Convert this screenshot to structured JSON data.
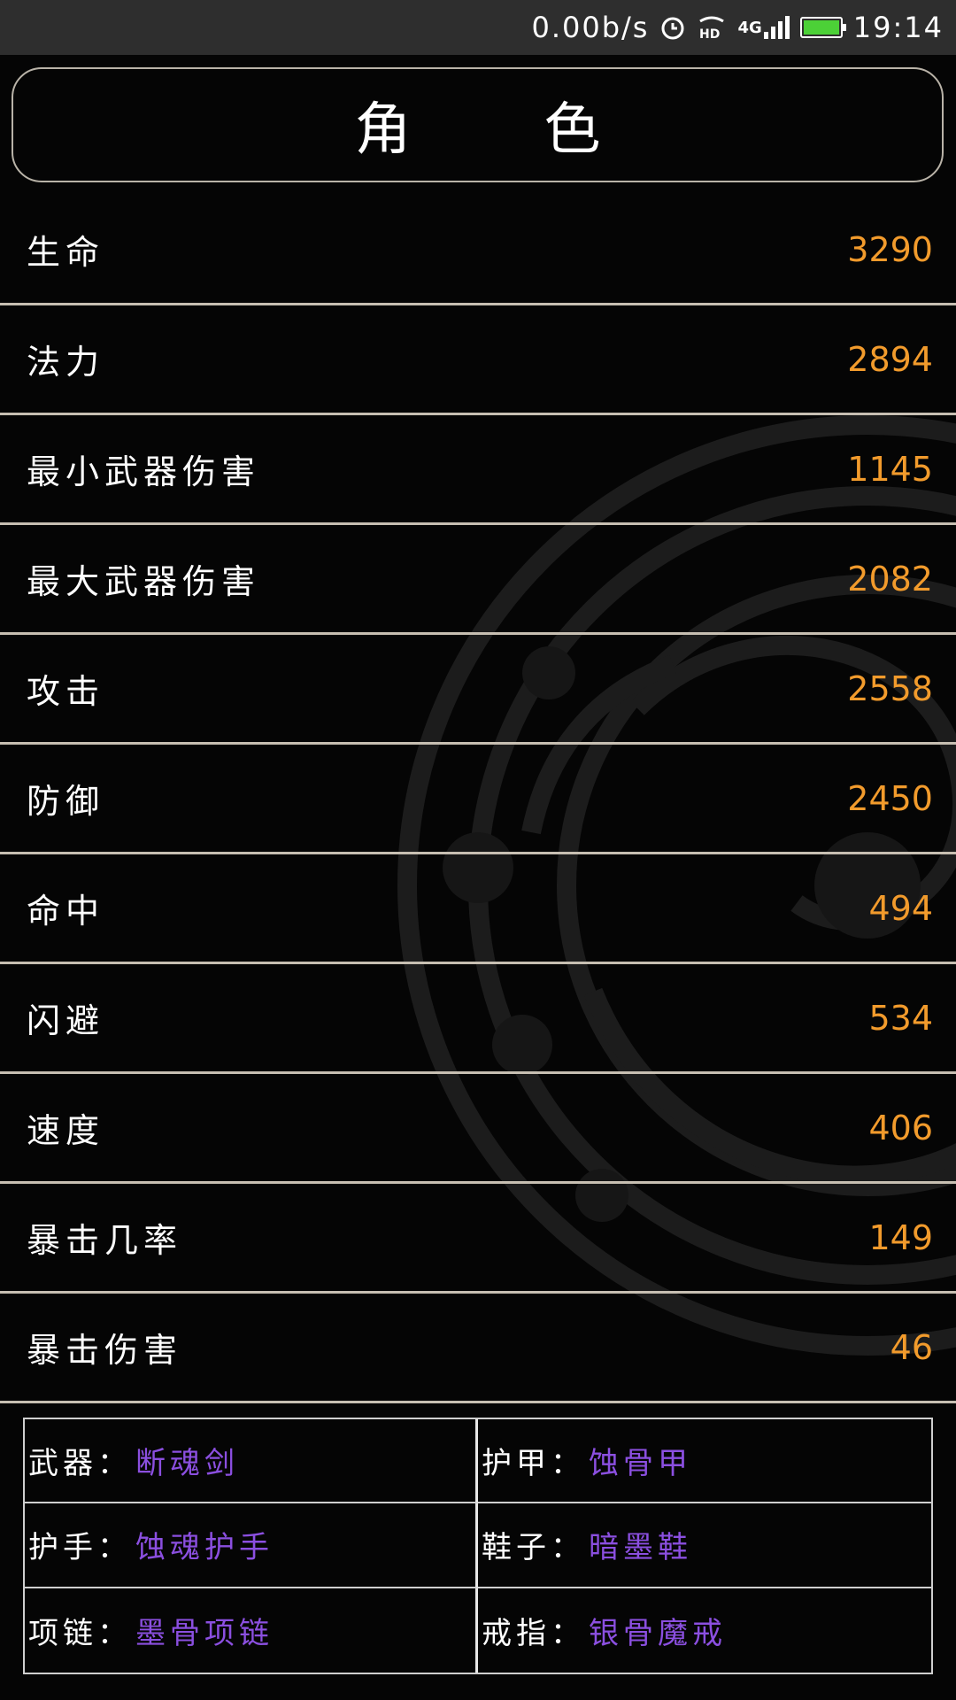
{
  "status_bar": {
    "net_speed": "0.00b/s",
    "network": "4G",
    "hd_label": "HD",
    "time": "19:14",
    "battery_color": "#4cd137"
  },
  "header": {
    "title": "角色"
  },
  "stats": [
    {
      "label": "生命",
      "value": "3290"
    },
    {
      "label": "法力",
      "value": "2894"
    },
    {
      "label": "最小武器伤害",
      "value": "1145"
    },
    {
      "label": "最大武器伤害",
      "value": "2082"
    },
    {
      "label": "攻击",
      "value": "2558"
    },
    {
      "label": "防御",
      "value": "2450"
    },
    {
      "label": "命中",
      "value": "494"
    },
    {
      "label": "闪避",
      "value": "534"
    },
    {
      "label": "速度",
      "value": "406"
    },
    {
      "label": "暴击几率",
      "value": "149"
    },
    {
      "label": "暴击伤害",
      "value": "46"
    }
  ],
  "equipment": [
    {
      "slot": "武器：",
      "item": "断魂剑"
    },
    {
      "slot": "护甲：",
      "item": "蚀骨甲"
    },
    {
      "slot": "护手：",
      "item": "蚀魂护手"
    },
    {
      "slot": "鞋子：",
      "item": "暗墨鞋"
    },
    {
      "slot": "项链：",
      "item": "墨骨项链"
    },
    {
      "slot": "戒指：",
      "item": "银骨魔戒"
    }
  ],
  "colors": {
    "stat_value": "#f29b2c",
    "equipment_item": "#8b4fe0",
    "background": "#050505",
    "divider": "#c7bfb2"
  }
}
